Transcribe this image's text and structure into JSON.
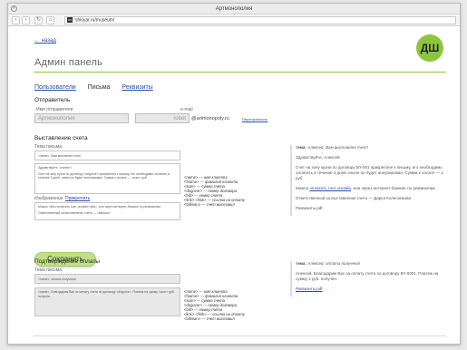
{
  "window": {
    "title": "Артмонополия",
    "close": "×"
  },
  "browser": {
    "back": "‹",
    "forward": "›",
    "reload": "↻",
    "home": "⌂",
    "favicon": "HS",
    "url": "shkiyar.ru/museum/"
  },
  "header": {
    "back_link": "← назад",
    "avatar": "ДШ",
    "page_title": "Админ панель"
  },
  "tabs": [
    "Пользователи",
    "Письма",
    "Реквизиты"
  ],
  "sender": {
    "section_title": "Отправитель",
    "name_label": "Имя отправителя",
    "name_value": "Артмонополия",
    "email_label": "e-mail",
    "email_value": "robot",
    "email_domain": "@artmonopoly.ru",
    "rename_link": "Переназначить"
  },
  "invoice": {
    "section_title": "Выставление счета",
    "subject_label": "Тема письма",
    "subject_value": "<name>, Вам выставлен счет!",
    "body_lines": [
      "Здравствуйте, <name>!",
      "Счет на зону кухни по договору <dogovor> прикреплен к письму, его необходимо оплатить в течение 3 дней, иначе он будет аннулирован. Сумма к оплате — <sum> руб."
    ],
    "image_label": "Изображение",
    "image_link": "Прикрепить",
    "footer_lines": [
      "Можно <link>оплатить счет онлайн</link>, или через интернет-банкинг по реквизитам.",
      "Ответственный за выставление счета — <billman>"
    ],
    "vars": [
      {
        "tag": "<name>",
        "desc": "имя клиента"
      },
      {
        "tag": "<fname>",
        "desc": "фамилия клиента"
      },
      {
        "tag": "<sum>",
        "desc": "сумма счета"
      },
      {
        "tag": "<dogovor>",
        "desc": "номер договора"
      },
      {
        "tag": "<bill>",
        "desc": "номер счета"
      },
      {
        "tag": "<link> </link>",
        "desc": "ссылка на оплату"
      },
      {
        "tag": "<billman>",
        "desc": "счет выставил"
      }
    ],
    "preview": {
      "subject_key": "тема:",
      "subject": "Алексей, Вам выставлен счет!",
      "greeting": "Здравствуйте, Алексей.",
      "body": "Счет на зону кухни по договору BY-001 прикреплен к письму, его необходимо оплатить в течение 3 дней, иначе он будет аннулирован. Сумма к оплате — 1 руб.",
      "pay_pre": "Можно",
      "pay_link": "оплатить счет онлайн",
      "pay_post": ", или через интернет-банкинг по реквизитам.",
      "responsible": "Ответственный за выставление счета — Дарья Колесникова",
      "attachment": "Реквизиты.pdf"
    }
  },
  "save_button": "Сохранить",
  "confirm": {
    "section_title": "Подтверждение оплаты",
    "subject_label": "Тема письма",
    "subject_value": "<name>, оплата получена!",
    "body": "<name>, Благодарим Вас за оплату счета по договору <dogovor>. Платеж на сумму <sum> руб. получен.",
    "vars": [
      {
        "tag": "<name>",
        "desc": "имя клиента"
      },
      {
        "tag": "<fname>",
        "desc": "фамилия клиента"
      },
      {
        "tag": "<sum>",
        "desc": "сумма счета"
      },
      {
        "tag": "<dogovor>",
        "desc": "номер договора"
      },
      {
        "tag": "<bill>",
        "desc": "номер счета"
      },
      {
        "tag": "<link> </link>",
        "desc": "ссылка на оплату"
      },
      {
        "tag": "<billman>",
        "desc": "счет выставил"
      }
    ],
    "preview": {
      "subject_key": "тема:",
      "subject": "Алексей, оплата получена!",
      "body": "Алексей, Благодарим Вас за оплату счета по договору BY-0001. Платеж на сумму 1 руб. получен.",
      "attachment": "Реквизиты.pdf"
    }
  }
}
